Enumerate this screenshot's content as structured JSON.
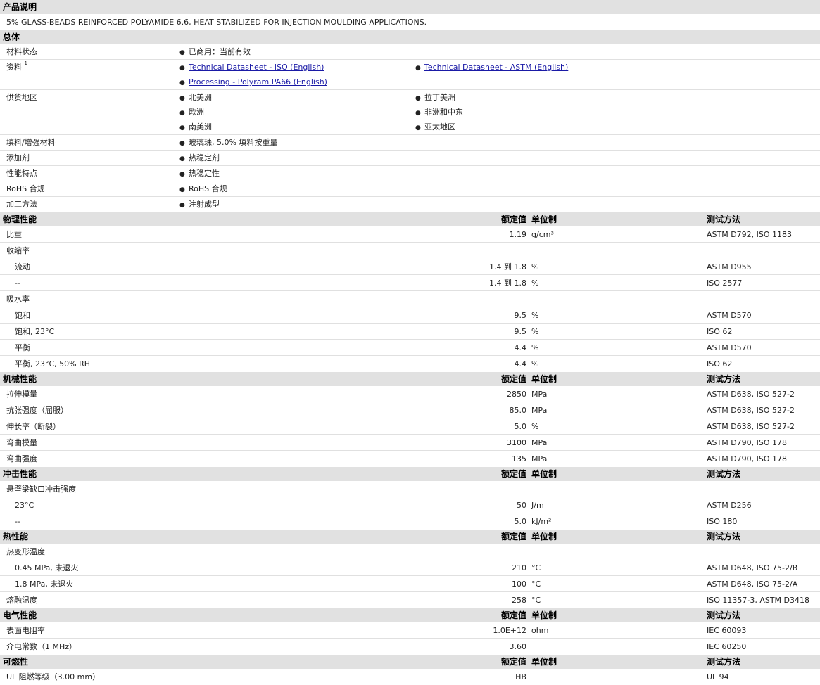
{
  "description": {
    "header": "产品说明",
    "text": "5% GLASS-BEADS REINFORCED POLYAMIDE 6.6, HEAT STABILIZED FOR INJECTION MOULDING APPLICATIONS."
  },
  "general": {
    "header": "总体",
    "rows": [
      {
        "label": "材料状态",
        "items": [
          {
            "text": "已商用：当前有效"
          }
        ]
      },
      {
        "label": "资料",
        "label_sup": "1",
        "items": [
          {
            "text": "Technical Datasheet - ISO (English)",
            "link": true
          },
          {
            "text": "Technical Datasheet - ASTM (English)",
            "link": true
          },
          {
            "text": "Processing - Polyram PA66 (English)",
            "link": true
          }
        ]
      },
      {
        "label": "供货地区",
        "items": [
          {
            "text": "北美洲"
          },
          {
            "text": "拉丁美洲"
          },
          {
            "text": "欧洲"
          },
          {
            "text": "非洲和中东"
          },
          {
            "text": "南美洲"
          },
          {
            "text": "亚太地区"
          }
        ]
      },
      {
        "label": "填料/增强材料",
        "items": [
          {
            "text": "玻璃珠, 5.0% 填料按重量"
          }
        ]
      },
      {
        "label": "添加剂",
        "items": [
          {
            "text": "热稳定剂"
          }
        ]
      },
      {
        "label": "性能特点",
        "items": [
          {
            "text": "热稳定性"
          }
        ]
      },
      {
        "label": "RoHS 合规",
        "items": [
          {
            "text": "RoHS 合规"
          }
        ]
      },
      {
        "label": "加工方法",
        "items": [
          {
            "text": "注射成型"
          }
        ]
      }
    ]
  },
  "column_headers": {
    "value": "额定值",
    "unit": "单位制",
    "test": "测试方法"
  },
  "sections": [
    {
      "title": "物理性能",
      "rows": [
        {
          "label": "比重",
          "value": "1.19",
          "unit": "g/cm³",
          "test": "ASTM D792, ISO 1183"
        },
        {
          "label": "收缩率"
        },
        {
          "label": "流动",
          "sub": true,
          "value": "1.4 到  1.8",
          "unit": "%",
          "test": "ASTM D955"
        },
        {
          "label": "--",
          "sub": true,
          "value": "1.4 到  1.8",
          "unit": "%",
          "test": "ISO 2577"
        },
        {
          "label": "吸水率"
        },
        {
          "label": "饱和",
          "sub": true,
          "value": "9.5",
          "unit": "%",
          "test": "ASTM D570"
        },
        {
          "label": "饱和, 23°C",
          "sub": true,
          "value": "9.5",
          "unit": "%",
          "test": "ISO 62"
        },
        {
          "label": "平衡",
          "sub": true,
          "value": "4.4",
          "unit": "%",
          "test": "ASTM D570"
        },
        {
          "label": "平衡, 23°C, 50% RH",
          "sub": true,
          "value": "4.4",
          "unit": "%",
          "test": "ISO 62"
        }
      ]
    },
    {
      "title": "机械性能",
      "rows": [
        {
          "label": "拉伸模量",
          "value": "2850",
          "unit": "MPa",
          "test": "ASTM D638, ISO 527-2"
        },
        {
          "label": "抗张强度（屈服）",
          "value": "85.0",
          "unit": "MPa",
          "test": "ASTM D638, ISO 527-2"
        },
        {
          "label": "伸长率（断裂）",
          "value": "5.0",
          "unit": "%",
          "test": "ASTM D638, ISO 527-2"
        },
        {
          "label": "弯曲模量",
          "value": "3100",
          "unit": "MPa",
          "test": "ASTM D790, ISO 178"
        },
        {
          "label": "弯曲强度",
          "value": "135",
          "unit": "MPa",
          "test": "ASTM D790, ISO 178"
        }
      ]
    },
    {
      "title": "冲击性能",
      "rows": [
        {
          "label": "悬壁梁缺口冲击强度"
        },
        {
          "label": "23°C",
          "sub": true,
          "value": "50",
          "unit": "J/m",
          "test": "ASTM D256"
        },
        {
          "label": "--",
          "sub": true,
          "value": "5.0",
          "unit": "kJ/m²",
          "test": "ISO 180"
        }
      ]
    },
    {
      "title": "热性能",
      "rows": [
        {
          "label": "热变形温度"
        },
        {
          "label": "0.45 MPa, 未退火",
          "sub": true,
          "value": "210",
          "unit": "°C",
          "test": "ASTM D648, ISO 75-2/B"
        },
        {
          "label": "1.8 MPa, 未退火",
          "sub": true,
          "value": "100",
          "unit": "°C",
          "test": "ASTM D648, ISO 75-2/A"
        },
        {
          "label": "熔融温度",
          "value": "258",
          "unit": "°C",
          "test": "ISO 11357-3, ASTM D3418"
        }
      ]
    },
    {
      "title": "电气性能",
      "rows": [
        {
          "label": "表面电阻率",
          "value": "1.0E+12",
          "unit": "ohm",
          "test": "IEC 60093"
        },
        {
          "label": "介电常数（1 MHz）",
          "value": "3.60",
          "unit": "",
          "test": "IEC 60250"
        }
      ]
    },
    {
      "title": "可燃性",
      "rows": [
        {
          "label": "UL 阻燃等级（3.00 mm）",
          "value": "HB",
          "unit": "",
          "test": "UL 94"
        }
      ]
    }
  ]
}
